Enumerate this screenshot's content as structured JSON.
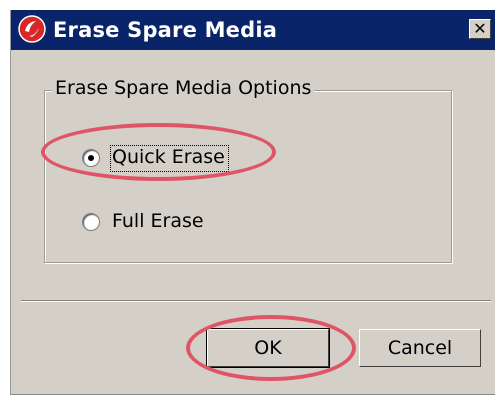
{
  "window": {
    "title": "Erase Spare Media",
    "close_glyph": "✕"
  },
  "options_group": {
    "legend": "Erase Spare Media Options",
    "quick_erase": {
      "label": "Quick Erase",
      "selected": true
    },
    "full_erase": {
      "label": "Full Erase",
      "selected": false
    }
  },
  "buttons": {
    "ok_label": "OK",
    "cancel_label": "Cancel"
  },
  "icons": {
    "app_icon": "app-logo-icon",
    "close": "close-icon"
  },
  "colors": {
    "titlebar": "#0a246a",
    "dialog_face": "#d4d0c8",
    "annotation": "#e05565"
  }
}
